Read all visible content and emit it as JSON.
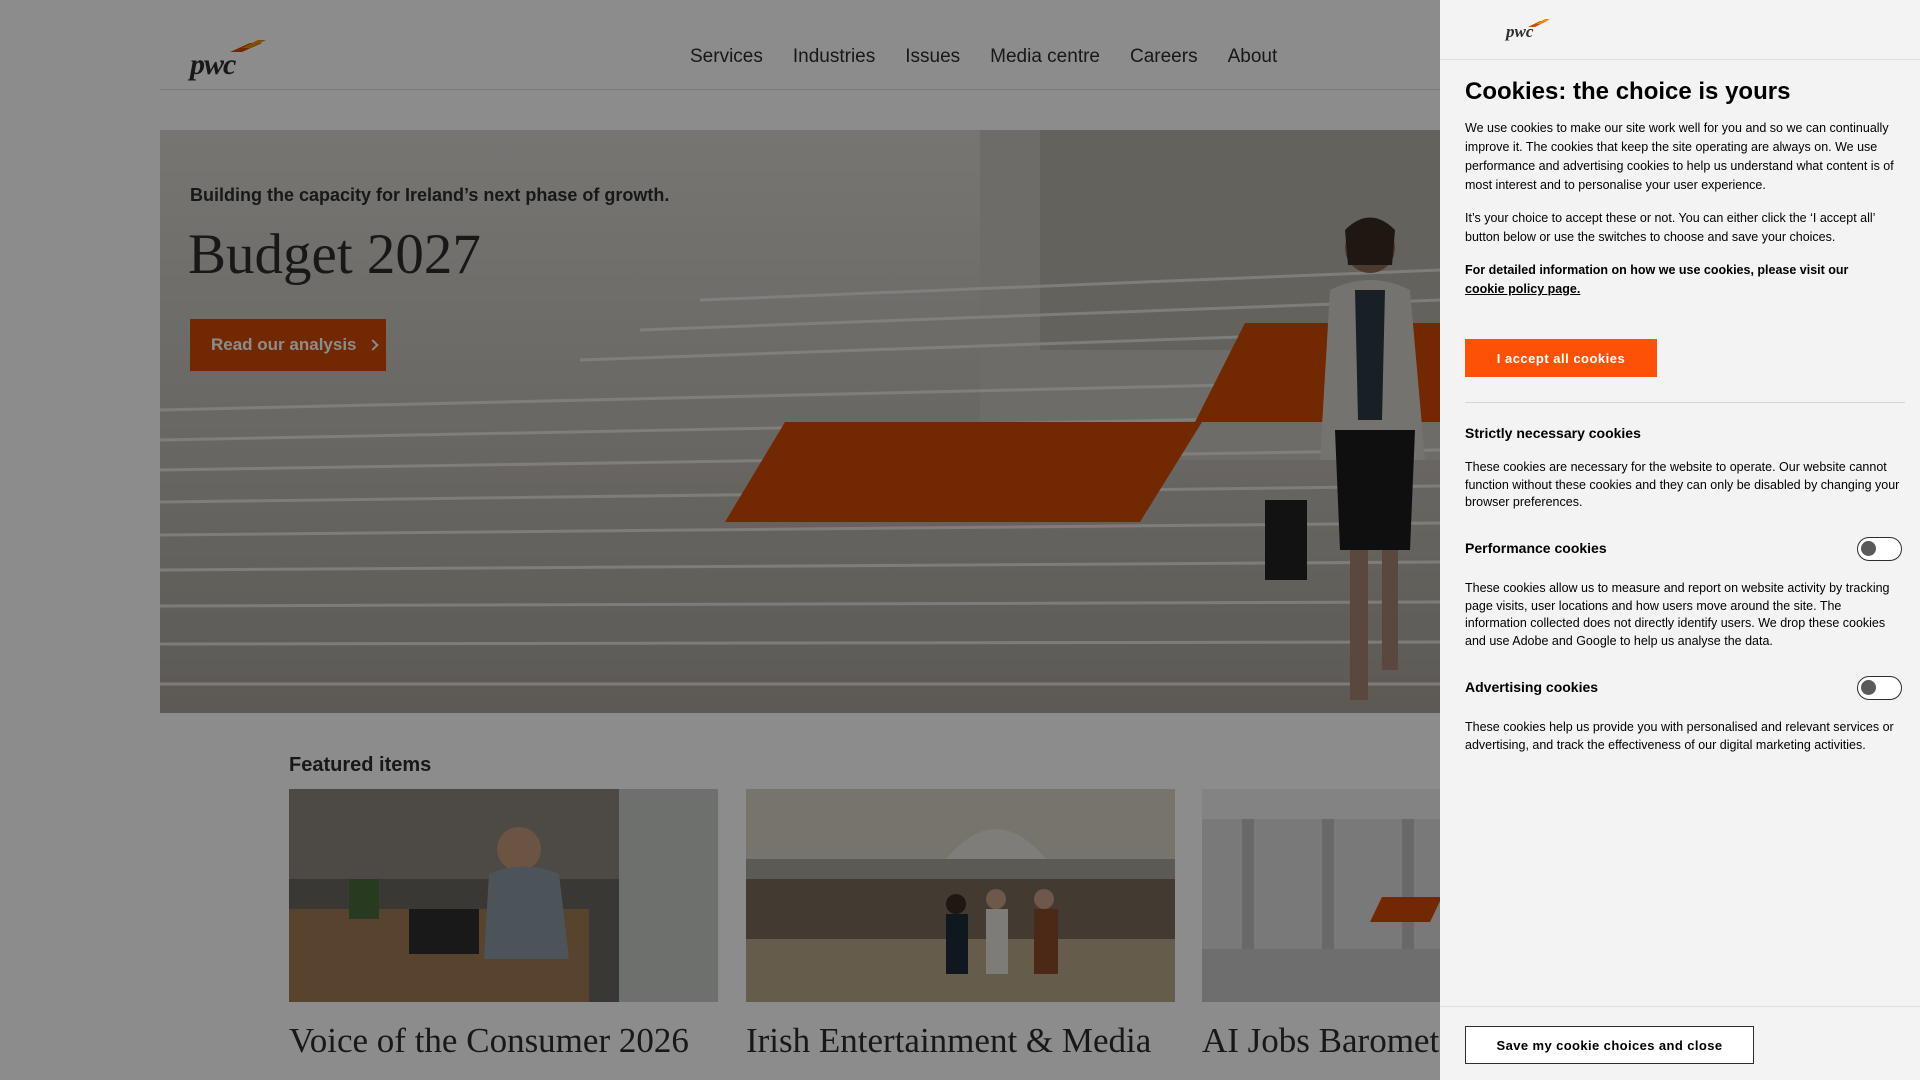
{
  "header": {
    "logo_text": "pwc",
    "nav": [
      "Services",
      "Industries",
      "Issues",
      "Media centre",
      "Careers",
      "About"
    ]
  },
  "hero": {
    "eyebrow": "Building the capacity for Ireland’s next phase of growth.",
    "title": "Budget 2027",
    "cta_label": "Read our analysis"
  },
  "featured": {
    "title": "Featured items",
    "cards": [
      {
        "title": "Voice of the Consumer 2026"
      },
      {
        "title": "Irish Entertainment & Media"
      },
      {
        "title": "AI Jobs Baromet"
      }
    ]
  },
  "cookie_panel": {
    "logo_text": "pwc",
    "title": "Cookies: the choice is yours",
    "intro": "We use cookies to make our site work well for you and so we can continually improve it. The cookies that keep the site operating are always on. We use performance and advertising cookies to help us understand what content is of most interest and to personalise your user experience.",
    "choice_text": "It’s your choice to accept these or not. You can either click the ‘I accept all’ button below or use the switches to choose and save your choices.",
    "policy_text": "For detailed information on how we use cookies, please visit our",
    "policy_link": "cookie policy page.",
    "accept_label": "I accept all cookies",
    "sections": [
      {
        "title": "Strictly necessary cookies",
        "text": "These cookies are necessary for the website to operate. Our website cannot function without these cookies and they can only be disabled by changing your browser preferences."
      },
      {
        "title": "Performance cookies",
        "text": "These cookies allow us to measure and report on website activity by tracking page visits, user locations and how users move around the site. The information collected does not directly identify users. We drop these cookies and use Adobe and Google to help us analyse the data.",
        "enabled": false
      },
      {
        "title": "Advertising cookies",
        "text": "These cookies help us provide you with personalised and relevant services or advertising, and track the effectiveness of our digital marketing activities.",
        "enabled": false
      }
    ],
    "save_label": "Save my cookie choices and close"
  },
  "colors": {
    "brand_orange": "#d04a02",
    "accept_orange": "#fd5108",
    "panel_bg": "#f3f3f3"
  }
}
